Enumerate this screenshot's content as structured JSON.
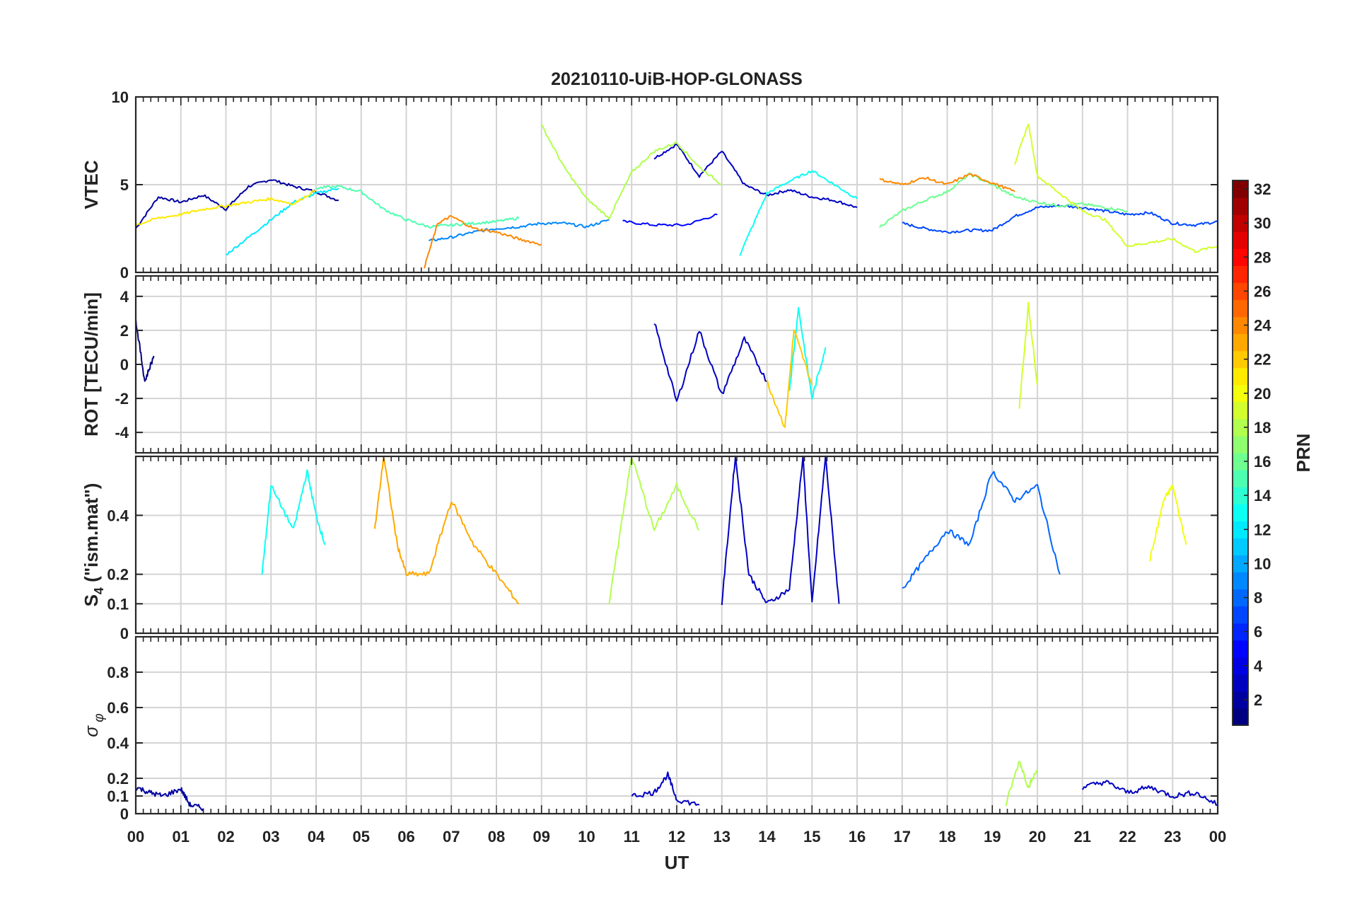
{
  "figure": {
    "title": "20210110-UiB-HOP-GLONASS",
    "xlabel": "UT",
    "x_ticks": [
      "00",
      "01",
      "02",
      "03",
      "04",
      "05",
      "06",
      "07",
      "08",
      "09",
      "10",
      "11",
      "12",
      "13",
      "14",
      "15",
      "16",
      "17",
      "18",
      "19",
      "20",
      "21",
      "22",
      "23",
      "00"
    ],
    "grid": true
  },
  "colorbar": {
    "label": "PRN",
    "range": [
      1,
      32
    ],
    "ticks": [
      "2",
      "4",
      "6",
      "8",
      "10",
      "12",
      "14",
      "16",
      "18",
      "20",
      "22",
      "24",
      "26",
      "28",
      "30",
      "32"
    ],
    "colormap": "jet",
    "placement": "right"
  },
  "chart_data": [
    {
      "type": "line",
      "panel": "vtec",
      "ylabel": "VTEC",
      "ylim": [
        0,
        10
      ],
      "y_ticks": [
        "0",
        "5",
        "10"
      ],
      "xlim_hours": [
        0,
        24
      ],
      "series": [
        {
          "prn": 2,
          "x": [
            0.0,
            0.5,
            1.0,
            1.5,
            2.0,
            2.5,
            3.0,
            3.5,
            4.0,
            4.5
          ],
          "y": [
            2.5,
            4.3,
            4.0,
            4.4,
            3.6,
            4.9,
            5.3,
            4.9,
            4.6,
            4.1
          ]
        },
        {
          "prn": 3,
          "x": [
            11.5,
            12.0,
            12.5,
            13.0,
            13.5,
            14.0,
            14.5,
            15.0,
            15.5,
            16.0
          ],
          "y": [
            6.5,
            7.3,
            5.5,
            6.9,
            5.0,
            4.4,
            4.7,
            4.3,
            4.1,
            3.7
          ]
        },
        {
          "prn": 5,
          "x": [
            10.8,
            11.5,
            12.2,
            12.9
          ],
          "y": [
            2.9,
            2.7,
            2.7,
            3.3
          ]
        },
        {
          "prn": 7,
          "x": [
            17.0,
            17.5,
            18.0,
            18.5,
            19.0,
            19.5,
            20.0,
            20.5,
            21.0,
            21.5,
            22.0,
            22.5,
            23.0,
            23.5,
            24.0
          ],
          "y": [
            2.8,
            2.5,
            2.3,
            2.4,
            2.4,
            3.2,
            3.7,
            3.8,
            3.7,
            3.5,
            3.3,
            3.4,
            2.8,
            2.7,
            2.9
          ]
        },
        {
          "prn": 9,
          "x": [
            6.5,
            7.0,
            7.5,
            8.0,
            8.5,
            9.0,
            9.5,
            10.0,
            10.5
          ],
          "y": [
            1.8,
            2.0,
            2.3,
            2.5,
            2.6,
            2.8,
            2.8,
            2.6,
            3.0
          ]
        },
        {
          "prn": 12,
          "x": [
            2.0,
            2.5,
            3.0,
            3.5,
            4.0,
            4.5
          ],
          "y": [
            1.0,
            2.0,
            3.0,
            4.0,
            4.5,
            4.8
          ]
        },
        {
          "prn": 13,
          "x": [
            13.4,
            14.0,
            14.5,
            15.0,
            15.5,
            16.0
          ],
          "y": [
            1.0,
            4.5,
            5.2,
            5.8,
            5.0,
            4.2
          ]
        },
        {
          "prn": 15,
          "x": [
            4.0,
            4.5,
            5.0,
            5.5,
            6.0,
            6.5,
            7.0,
            7.5,
            8.0,
            8.5
          ],
          "y": [
            4.8,
            4.9,
            4.6,
            3.6,
            3.0,
            2.6,
            2.7,
            2.8,
            2.9,
            3.1
          ]
        },
        {
          "prn": 16,
          "x": [
            16.5,
            17.0,
            17.5,
            18.0,
            18.5,
            19.0,
            19.5,
            20.0,
            20.5,
            21.0,
            21.5,
            22.0
          ],
          "y": [
            2.6,
            3.5,
            4.1,
            4.6,
            5.6,
            5.0,
            4.3,
            4.0,
            3.8,
            3.9,
            3.7,
            3.5
          ]
        },
        {
          "prn": 18,
          "x": [
            9.0,
            9.5,
            10.0,
            10.5,
            11.0,
            11.5,
            12.0,
            12.5,
            13.0
          ],
          "y": [
            8.4,
            6.0,
            4.2,
            3.1,
            5.7,
            6.9,
            7.4,
            6.0,
            5.0
          ]
        },
        {
          "prn": 19,
          "x": [
            19.5,
            19.8,
            20.0,
            20.5,
            21.0,
            21.5,
            22.0,
            22.5,
            23.0,
            23.5,
            24.0
          ],
          "y": [
            6.2,
            8.5,
            5.5,
            4.5,
            3.5,
            3.0,
            1.5,
            1.7,
            1.9,
            1.2,
            1.5
          ]
        },
        {
          "prn": 21,
          "x": [
            0.0,
            0.5,
            1.0,
            1.5,
            2.0,
            2.5,
            3.0,
            3.5,
            4.0
          ],
          "y": [
            2.7,
            3.1,
            3.3,
            3.6,
            3.8,
            4.0,
            4.2,
            3.9,
            4.7
          ]
        },
        {
          "prn": 24,
          "x": [
            6.4,
            6.7,
            7.0,
            7.5,
            8.0,
            8.5,
            9.0
          ],
          "y": [
            0.3,
            2.8,
            3.2,
            2.5,
            2.3,
            1.9,
            1.6
          ]
        },
        {
          "prn": 24,
          "x": [
            16.5,
            17.0,
            17.5,
            18.0,
            18.5,
            19.0,
            19.5
          ],
          "y": [
            5.3,
            5.0,
            5.4,
            5.0,
            5.6,
            5.1,
            4.6
          ]
        }
      ]
    },
    {
      "type": "line",
      "panel": "rot",
      "ylabel": "ROT [TECU/min]",
      "ylim": [
        -5.2,
        5.2
      ],
      "y_ticks": [
        "-4",
        "-2",
        "0",
        "2",
        "4"
      ],
      "xlim_hours": [
        0,
        24
      ],
      "series": [
        {
          "prn": 3,
          "x": [
            11.5,
            12.0,
            12.5,
            13.0,
            13.5,
            14.0
          ],
          "y": [
            2.5,
            -2.2,
            2.0,
            -1.8,
            1.5,
            -1.0
          ]
        },
        {
          "prn": 13,
          "x": [
            14.5,
            14.7,
            15.0,
            15.3
          ],
          "y": [
            -1.5,
            3.3,
            -2.0,
            1.0
          ]
        },
        {
          "prn": 22,
          "x": [
            14.0,
            14.4,
            14.6,
            15.0
          ],
          "y": [
            -1.0,
            -3.7,
            2.0,
            -1.2
          ]
        },
        {
          "prn": 19,
          "x": [
            19.6,
            19.8,
            20.0
          ],
          "y": [
            -2.5,
            3.5,
            -1.2
          ]
        },
        {
          "prn": 1,
          "x": [
            0.0,
            0.2,
            0.4
          ],
          "y": [
            2.6,
            -1.0,
            0.5
          ]
        }
      ]
    },
    {
      "type": "line",
      "panel": "s4",
      "ylabel": "S_4 (\"ism.mat\")",
      "ylim": [
        0,
        0.6
      ],
      "y_ticks": [
        "0",
        "0.1",
        "0.2",
        "0.4"
      ],
      "xlim_hours": [
        0,
        24
      ],
      "series": [
        {
          "prn": 3,
          "x": [
            13.0,
            13.3,
            13.6,
            14.0,
            14.5,
            14.8,
            15.0,
            15.3,
            15.6
          ],
          "y": [
            0.1,
            0.6,
            0.2,
            0.1,
            0.15,
            0.6,
            0.1,
            0.6,
            0.1
          ]
        },
        {
          "prn": 8,
          "x": [
            17.0,
            17.5,
            18.0,
            18.5,
            19.0,
            19.5,
            20.0,
            20.5
          ],
          "y": [
            0.15,
            0.25,
            0.35,
            0.3,
            0.55,
            0.45,
            0.5,
            0.2
          ]
        },
        {
          "prn": 23,
          "x": [
            5.3,
            5.5,
            5.8,
            6.0,
            6.5,
            7.0,
            7.5,
            8.0,
            8.5
          ],
          "y": [
            0.35,
            0.6,
            0.3,
            0.2,
            0.2,
            0.45,
            0.3,
            0.2,
            0.1
          ]
        },
        {
          "prn": 13,
          "x": [
            2.8,
            3.0,
            3.5,
            3.8,
            4.0,
            4.2
          ],
          "y": [
            0.2,
            0.5,
            0.35,
            0.55,
            0.4,
            0.3
          ]
        },
        {
          "prn": 18,
          "x": [
            10.5,
            10.8,
            11.0,
            11.5,
            12.0,
            12.5
          ],
          "y": [
            0.1,
            0.4,
            0.6,
            0.35,
            0.5,
            0.35
          ]
        },
        {
          "prn": 20,
          "x": [
            22.5,
            22.8,
            23.0,
            23.3
          ],
          "y": [
            0.25,
            0.45,
            0.5,
            0.3
          ]
        }
      ]
    },
    {
      "type": "line",
      "panel": "sigma_phi",
      "ylabel": "σ_φ",
      "ylim": [
        0,
        1
      ],
      "y_ticks": [
        "0",
        "0.1",
        "0.2",
        "0.4",
        "0.6",
        "0.8"
      ],
      "xlim_hours": [
        0,
        24
      ],
      "series": [
        {
          "prn": 2,
          "x": [
            0.0,
            0.3,
            0.6,
            1.0,
            1.2,
            1.5
          ],
          "y": [
            0.15,
            0.12,
            0.1,
            0.14,
            0.05,
            0.03
          ]
        },
        {
          "prn": 3,
          "x": [
            11.0,
            11.5,
            11.8,
            12.0,
            12.5
          ],
          "y": [
            0.1,
            0.12,
            0.22,
            0.08,
            0.05
          ]
        },
        {
          "prn": 18,
          "x": [
            19.3,
            19.6,
            19.8,
            20.0
          ],
          "y": [
            0.05,
            0.3,
            0.15,
            0.25
          ]
        },
        {
          "prn": 3,
          "x": [
            21.0,
            21.5,
            22.0,
            22.5,
            23.0,
            23.5,
            24.0
          ],
          "y": [
            0.15,
            0.18,
            0.12,
            0.15,
            0.1,
            0.12,
            0.05
          ]
        }
      ]
    }
  ]
}
